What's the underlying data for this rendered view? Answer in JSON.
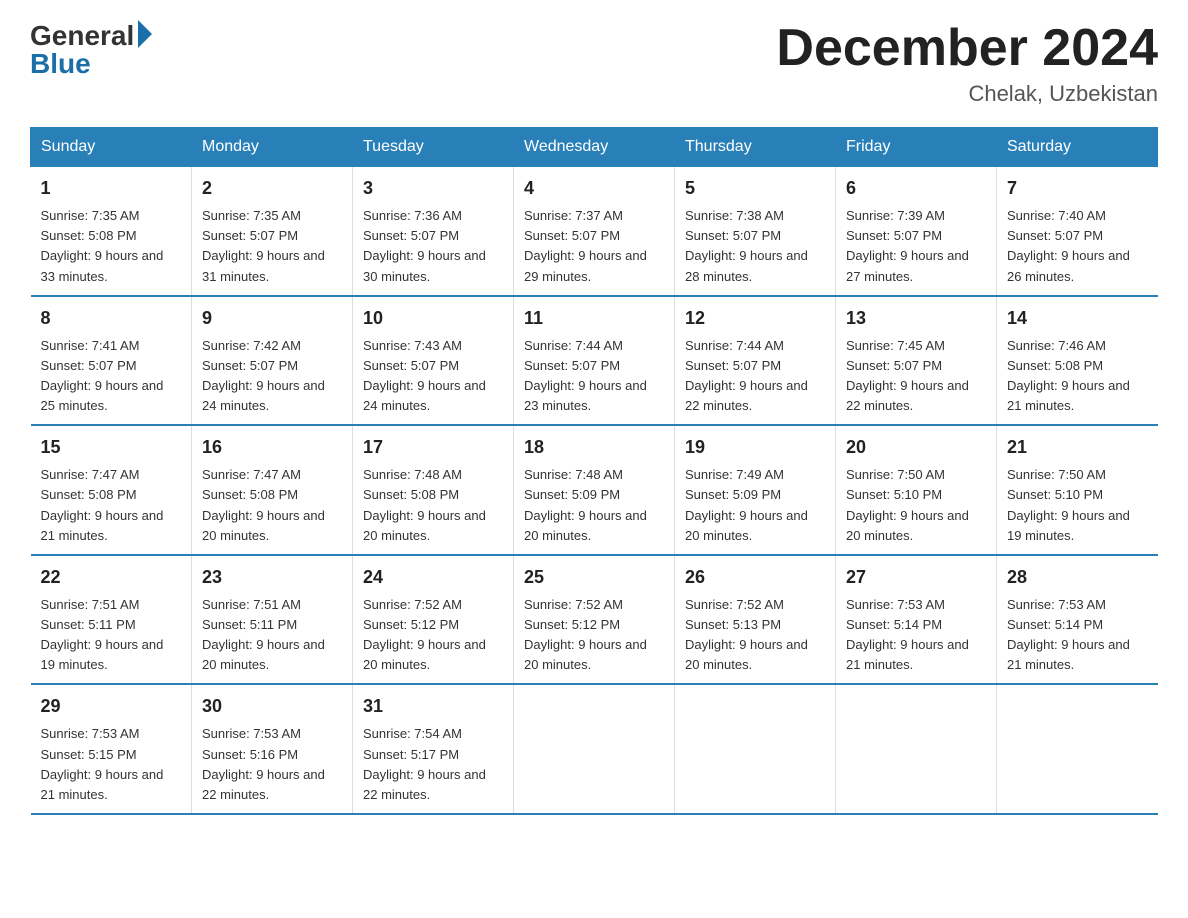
{
  "logo": {
    "general": "General",
    "blue": "Blue"
  },
  "title": "December 2024",
  "subtitle": "Chelak, Uzbekistan",
  "header_days": [
    "Sunday",
    "Monday",
    "Tuesday",
    "Wednesday",
    "Thursday",
    "Friday",
    "Saturday"
  ],
  "weeks": [
    [
      {
        "day": "1",
        "sunrise": "7:35 AM",
        "sunset": "5:08 PM",
        "daylight": "9 hours and 33 minutes."
      },
      {
        "day": "2",
        "sunrise": "7:35 AM",
        "sunset": "5:07 PM",
        "daylight": "9 hours and 31 minutes."
      },
      {
        "day": "3",
        "sunrise": "7:36 AM",
        "sunset": "5:07 PM",
        "daylight": "9 hours and 30 minutes."
      },
      {
        "day": "4",
        "sunrise": "7:37 AM",
        "sunset": "5:07 PM",
        "daylight": "9 hours and 29 minutes."
      },
      {
        "day": "5",
        "sunrise": "7:38 AM",
        "sunset": "5:07 PM",
        "daylight": "9 hours and 28 minutes."
      },
      {
        "day": "6",
        "sunrise": "7:39 AM",
        "sunset": "5:07 PM",
        "daylight": "9 hours and 27 minutes."
      },
      {
        "day": "7",
        "sunrise": "7:40 AM",
        "sunset": "5:07 PM",
        "daylight": "9 hours and 26 minutes."
      }
    ],
    [
      {
        "day": "8",
        "sunrise": "7:41 AM",
        "sunset": "5:07 PM",
        "daylight": "9 hours and 25 minutes."
      },
      {
        "day": "9",
        "sunrise": "7:42 AM",
        "sunset": "5:07 PM",
        "daylight": "9 hours and 24 minutes."
      },
      {
        "day": "10",
        "sunrise": "7:43 AM",
        "sunset": "5:07 PM",
        "daylight": "9 hours and 24 minutes."
      },
      {
        "day": "11",
        "sunrise": "7:44 AM",
        "sunset": "5:07 PM",
        "daylight": "9 hours and 23 minutes."
      },
      {
        "day": "12",
        "sunrise": "7:44 AM",
        "sunset": "5:07 PM",
        "daylight": "9 hours and 22 minutes."
      },
      {
        "day": "13",
        "sunrise": "7:45 AM",
        "sunset": "5:07 PM",
        "daylight": "9 hours and 22 minutes."
      },
      {
        "day": "14",
        "sunrise": "7:46 AM",
        "sunset": "5:08 PM",
        "daylight": "9 hours and 21 minutes."
      }
    ],
    [
      {
        "day": "15",
        "sunrise": "7:47 AM",
        "sunset": "5:08 PM",
        "daylight": "9 hours and 21 minutes."
      },
      {
        "day": "16",
        "sunrise": "7:47 AM",
        "sunset": "5:08 PM",
        "daylight": "9 hours and 20 minutes."
      },
      {
        "day": "17",
        "sunrise": "7:48 AM",
        "sunset": "5:08 PM",
        "daylight": "9 hours and 20 minutes."
      },
      {
        "day": "18",
        "sunrise": "7:48 AM",
        "sunset": "5:09 PM",
        "daylight": "9 hours and 20 minutes."
      },
      {
        "day": "19",
        "sunrise": "7:49 AM",
        "sunset": "5:09 PM",
        "daylight": "9 hours and 20 minutes."
      },
      {
        "day": "20",
        "sunrise": "7:50 AM",
        "sunset": "5:10 PM",
        "daylight": "9 hours and 20 minutes."
      },
      {
        "day": "21",
        "sunrise": "7:50 AM",
        "sunset": "5:10 PM",
        "daylight": "9 hours and 19 minutes."
      }
    ],
    [
      {
        "day": "22",
        "sunrise": "7:51 AM",
        "sunset": "5:11 PM",
        "daylight": "9 hours and 19 minutes."
      },
      {
        "day": "23",
        "sunrise": "7:51 AM",
        "sunset": "5:11 PM",
        "daylight": "9 hours and 20 minutes."
      },
      {
        "day": "24",
        "sunrise": "7:52 AM",
        "sunset": "5:12 PM",
        "daylight": "9 hours and 20 minutes."
      },
      {
        "day": "25",
        "sunrise": "7:52 AM",
        "sunset": "5:12 PM",
        "daylight": "9 hours and 20 minutes."
      },
      {
        "day": "26",
        "sunrise": "7:52 AM",
        "sunset": "5:13 PM",
        "daylight": "9 hours and 20 minutes."
      },
      {
        "day": "27",
        "sunrise": "7:53 AM",
        "sunset": "5:14 PM",
        "daylight": "9 hours and 21 minutes."
      },
      {
        "day": "28",
        "sunrise": "7:53 AM",
        "sunset": "5:14 PM",
        "daylight": "9 hours and 21 minutes."
      }
    ],
    [
      {
        "day": "29",
        "sunrise": "7:53 AM",
        "sunset": "5:15 PM",
        "daylight": "9 hours and 21 minutes."
      },
      {
        "day": "30",
        "sunrise": "7:53 AM",
        "sunset": "5:16 PM",
        "daylight": "9 hours and 22 minutes."
      },
      {
        "day": "31",
        "sunrise": "7:54 AM",
        "sunset": "5:17 PM",
        "daylight": "9 hours and 22 minutes."
      },
      null,
      null,
      null,
      null
    ]
  ]
}
